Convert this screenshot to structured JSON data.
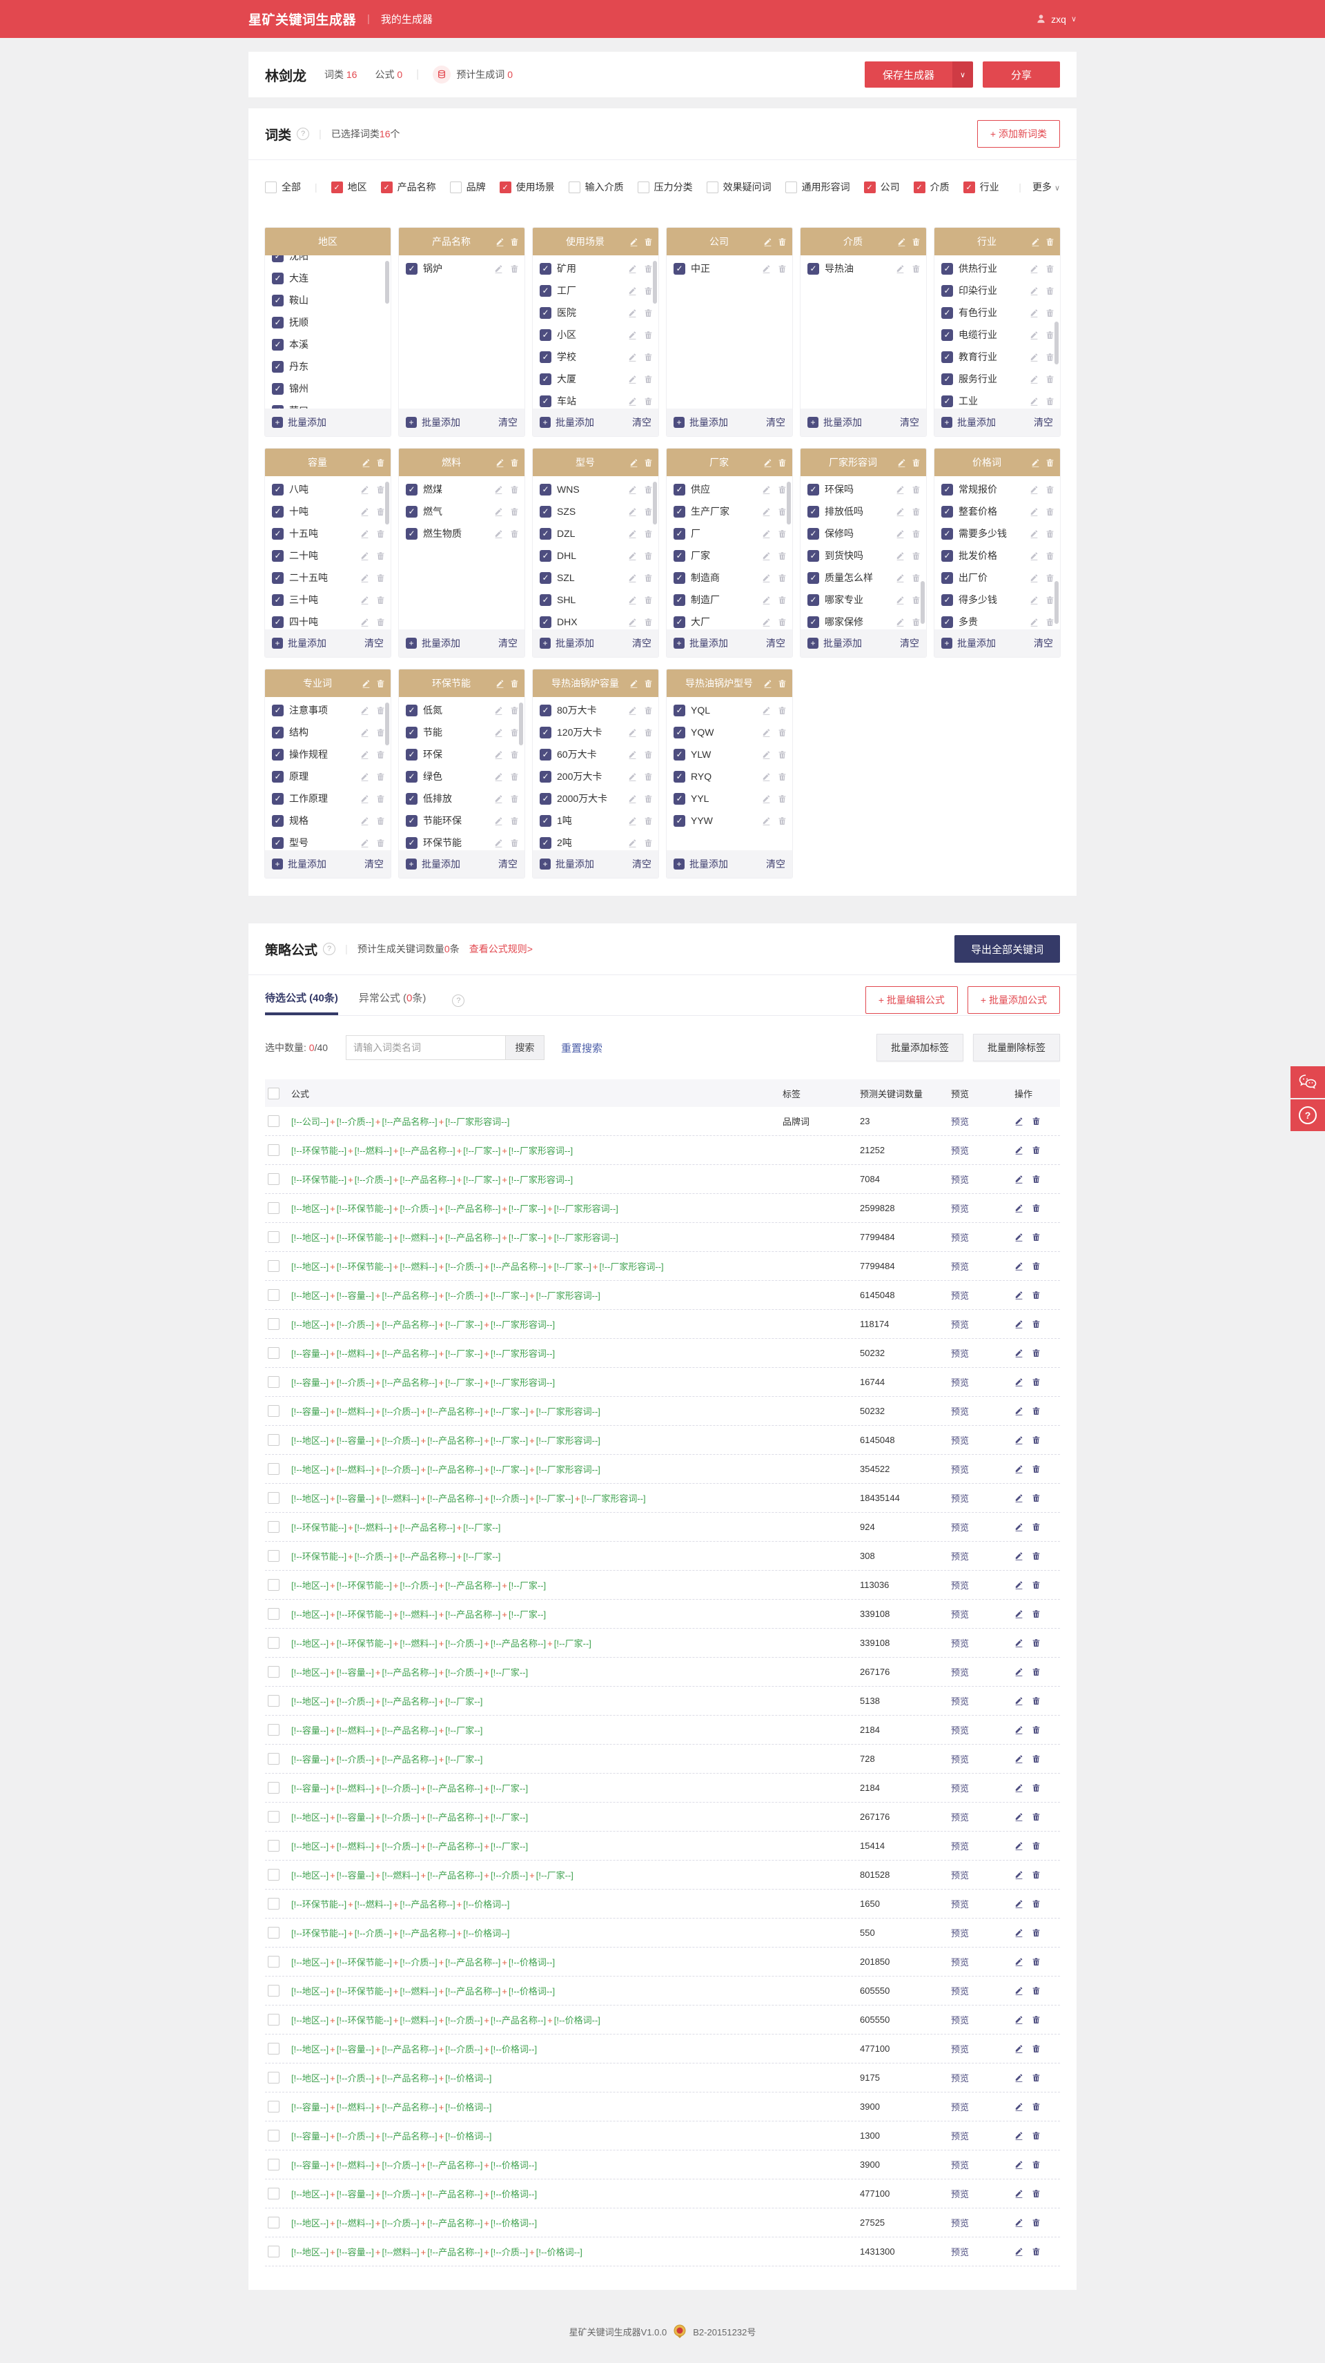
{
  "colors": {
    "primary_red": "#e2484f",
    "navy_button": "#353a68",
    "card_header_tan": "#d0b284",
    "item_checkbox_navy": "#4d4d7f",
    "formula_green": "#3fa14f",
    "formula_plus_orange": "#e25a3d",
    "preview_indigo": "#4e4e80"
  },
  "navbar": {
    "brand": "星矿关键词生成器",
    "menu": "我的生成器",
    "user": "zxq"
  },
  "userbar": {
    "name": "林剑龙",
    "wordclass_label": "词类",
    "wordclass_count": "16",
    "formula_label": "公式",
    "formula_count": "0",
    "estimate_label": "预计生成词",
    "estimate_count": "0",
    "save_button": "保存生成器",
    "share_button": "分享"
  },
  "wordclass_section": {
    "title": "词类",
    "selected_prefix": "已选择词类",
    "selected_count": "16",
    "selected_suffix": "个",
    "add_button": "+ 添加新词类",
    "more_label": "更多",
    "batch_add_label": "批量添加",
    "clear_label": "清空",
    "filters": [
      {
        "label": "全部",
        "checked": false,
        "divider_after": true
      },
      {
        "label": "地区",
        "checked": true
      },
      {
        "label": "产品名称",
        "checked": true
      },
      {
        "label": "品牌",
        "checked": false
      },
      {
        "label": "使用场景",
        "checked": true
      },
      {
        "label": "输入介质",
        "checked": false
      },
      {
        "label": "压力分类",
        "checked": false
      },
      {
        "label": "效果疑问词",
        "checked": false
      },
      {
        "label": "通用形容词",
        "checked": false
      },
      {
        "label": "公司",
        "checked": true
      },
      {
        "label": "介质",
        "checked": true
      },
      {
        "label": "行业",
        "checked": true
      }
    ],
    "cards": [
      {
        "title": "地区",
        "head_icons": false,
        "item_icons": false,
        "clear": false,
        "scrollbar": "top",
        "offset": true,
        "items": [
          "沈阳",
          "大连",
          "鞍山",
          "抚顺",
          "本溪",
          "丹东",
          "锦州",
          "营口"
        ]
      },
      {
        "title": "产品名称",
        "head_icons": true,
        "item_icons": true,
        "clear": true,
        "scrollbar": null,
        "offset": false,
        "items": [
          "锅炉"
        ]
      },
      {
        "title": "使用场景",
        "head_icons": true,
        "item_icons": true,
        "clear": true,
        "scrollbar": "top",
        "offset": false,
        "items": [
          "矿用",
          "工厂",
          "医院",
          "小区",
          "学校",
          "大厦",
          "车站"
        ]
      },
      {
        "title": "公司",
        "head_icons": true,
        "item_icons": true,
        "clear": true,
        "scrollbar": null,
        "offset": false,
        "items": [
          "中正"
        ]
      },
      {
        "title": "介质",
        "head_icons": true,
        "item_icons": true,
        "clear": true,
        "scrollbar": null,
        "offset": false,
        "items": [
          "导热油"
        ]
      },
      {
        "title": "行业",
        "head_icons": true,
        "item_icons": true,
        "clear": true,
        "scrollbar": "mid",
        "offset": false,
        "items": [
          "供热行业",
          "印染行业",
          "有色行业",
          "电缆行业",
          "教育行业",
          "服务行业",
          "工业"
        ]
      },
      {
        "title": "容量",
        "head_icons": true,
        "item_icons": true,
        "clear": true,
        "scrollbar": "top",
        "offset": false,
        "items": [
          "八吨",
          "十吨",
          "十五吨",
          "二十吨",
          "二十五吨",
          "三十吨",
          "四十吨"
        ]
      },
      {
        "title": "燃料",
        "head_icons": true,
        "item_icons": true,
        "clear": true,
        "scrollbar": null,
        "offset": false,
        "items": [
          "燃煤",
          "燃气",
          "燃生物质"
        ]
      },
      {
        "title": "型号",
        "head_icons": true,
        "item_icons": true,
        "clear": true,
        "scrollbar": "top",
        "offset": false,
        "items": [
          "WNS",
          "SZS",
          "DZL",
          "DHL",
          "SZL",
          "SHL",
          "DHX"
        ]
      },
      {
        "title": "厂家",
        "head_icons": true,
        "item_icons": true,
        "clear": true,
        "scrollbar": "top",
        "offset": false,
        "items": [
          "供应",
          "生产厂家",
          "厂",
          "厂家",
          "制造商",
          "制造厂",
          "大厂"
        ]
      },
      {
        "title": "厂家形容词",
        "head_icons": true,
        "item_icons": true,
        "clear": true,
        "scrollbar": "bottom",
        "offset": false,
        "items": [
          "环保吗",
          "排放低吗",
          "保修吗",
          "到货快吗",
          "质量怎么样",
          "哪家专业",
          "哪家保修"
        ]
      },
      {
        "title": "价格词",
        "head_icons": true,
        "item_icons": true,
        "clear": true,
        "scrollbar": "bottom",
        "offset": false,
        "items": [
          "常规报价",
          "整套价格",
          "需要多少钱",
          "批发价格",
          "出厂价",
          "得多少钱",
          "多贵"
        ]
      },
      {
        "title": "专业词",
        "head_icons": true,
        "item_icons": true,
        "clear": true,
        "scrollbar": "top",
        "offset": false,
        "items": [
          "注意事项",
          "结构",
          "操作规程",
          "原理",
          "工作原理",
          "规格",
          "型号"
        ]
      },
      {
        "title": "环保节能",
        "head_icons": true,
        "item_icons": true,
        "clear": true,
        "scrollbar": "top",
        "offset": false,
        "items": [
          "低氮",
          "节能",
          "环保",
          "绿色",
          "低排放",
          "节能环保",
          "环保节能"
        ]
      },
      {
        "title": "导热油锅炉容量",
        "head_icons": true,
        "item_icons": true,
        "clear": true,
        "scrollbar": null,
        "offset": false,
        "items": [
          "80万大卡",
          "120万大卡",
          "60万大卡",
          "200万大卡",
          "2000万大卡",
          "1吨",
          "2吨"
        ]
      },
      {
        "title": "导热油锅炉型号",
        "head_icons": true,
        "item_icons": true,
        "clear": true,
        "scrollbar": null,
        "offset": false,
        "items": [
          "YQL",
          "YQW",
          "YLW",
          "RYQ",
          "YYL",
          "YYW"
        ]
      }
    ]
  },
  "formula_section": {
    "title": "策略公式",
    "estimate_prefix": "预计生成关键词数量",
    "estimate_count": "0",
    "estimate_suffix": "条",
    "rules_link": "查看公式规则>",
    "export_button": "导出全部关键词",
    "tabs": [
      {
        "name": "待选公式",
        "count": "40",
        "suffix": "条",
        "active": true,
        "count_red": false
      },
      {
        "name": "异常公式",
        "count": "0",
        "suffix": "条",
        "active": false,
        "count_red": true
      }
    ],
    "batch_edit_button": "+ 批量编辑公式",
    "batch_add_button": "+ 批量添加公式",
    "selected_label": "选中数量:",
    "selected_zero": "0",
    "selected_total": "/40",
    "search_placeholder": "请输入词类名词",
    "search_button": "搜索",
    "reset_button": "重置搜索",
    "tag_add_button": "批量添加标签",
    "tag_del_button": "批量删除标签",
    "table": {
      "headers": {
        "formula": "公式",
        "tag": "标签",
        "count": "预测关键词数量",
        "preview": "预览",
        "ops": "操作"
      },
      "preview_label": "预览",
      "rows": [
        {
          "parts": [
            "公司",
            "介质",
            "产品名称",
            "厂家形容词"
          ],
          "tag": "品牌词",
          "count": "23"
        },
        {
          "parts": [
            "环保节能",
            "燃料",
            "产品名称",
            "厂家",
            "厂家形容词"
          ],
          "tag": "",
          "count": "21252"
        },
        {
          "parts": [
            "环保节能",
            "介质",
            "产品名称",
            "厂家",
            "厂家形容词"
          ],
          "tag": "",
          "count": "7084"
        },
        {
          "parts": [
            "地区",
            "环保节能",
            "介质",
            "产品名称",
            "厂家",
            "厂家形容词"
          ],
          "tag": "",
          "count": "2599828"
        },
        {
          "parts": [
            "地区",
            "环保节能",
            "燃料",
            "产品名称",
            "厂家",
            "厂家形容词"
          ],
          "tag": "",
          "count": "7799484"
        },
        {
          "parts": [
            "地区",
            "环保节能",
            "燃料",
            "介质",
            "产品名称",
            "厂家",
            "厂家形容词"
          ],
          "tag": "",
          "count": "7799484"
        },
        {
          "parts": [
            "地区",
            "容量",
            "产品名称",
            "介质",
            "厂家",
            "厂家形容词"
          ],
          "tag": "",
          "count": "6145048"
        },
        {
          "parts": [
            "地区",
            "介质",
            "产品名称",
            "厂家",
            "厂家形容词"
          ],
          "tag": "",
          "count": "118174"
        },
        {
          "parts": [
            "容量",
            "燃料",
            "产品名称",
            "厂家",
            "厂家形容词"
          ],
          "tag": "",
          "count": "50232"
        },
        {
          "parts": [
            "容量",
            "介质",
            "产品名称",
            "厂家",
            "厂家形容词"
          ],
          "tag": "",
          "count": "16744"
        },
        {
          "parts": [
            "容量",
            "燃料",
            "介质",
            "产品名称",
            "厂家",
            "厂家形容词"
          ],
          "tag": "",
          "count": "50232"
        },
        {
          "parts": [
            "地区",
            "容量",
            "介质",
            "产品名称",
            "厂家",
            "厂家形容词"
          ],
          "tag": "",
          "count": "6145048"
        },
        {
          "parts": [
            "地区",
            "燃料",
            "介质",
            "产品名称",
            "厂家",
            "厂家形容词"
          ],
          "tag": "",
          "count": "354522"
        },
        {
          "parts": [
            "地区",
            "容量",
            "燃料",
            "产品名称",
            "介质",
            "厂家",
            "厂家形容词"
          ],
          "tag": "",
          "count": "18435144"
        },
        {
          "parts": [
            "环保节能",
            "燃料",
            "产品名称",
            "厂家"
          ],
          "tag": "",
          "count": "924"
        },
        {
          "parts": [
            "环保节能",
            "介质",
            "产品名称",
            "厂家"
          ],
          "tag": "",
          "count": "308"
        },
        {
          "parts": [
            "地区",
            "环保节能",
            "介质",
            "产品名称",
            "厂家"
          ],
          "tag": "",
          "count": "113036"
        },
        {
          "parts": [
            "地区",
            "环保节能",
            "燃料",
            "产品名称",
            "厂家"
          ],
          "tag": "",
          "count": "339108"
        },
        {
          "parts": [
            "地区",
            "环保节能",
            "燃料",
            "介质",
            "产品名称",
            "厂家"
          ],
          "tag": "",
          "count": "339108"
        },
        {
          "parts": [
            "地区",
            "容量",
            "产品名称",
            "介质",
            "厂家"
          ],
          "tag": "",
          "count": "267176"
        },
        {
          "parts": [
            "地区",
            "介质",
            "产品名称",
            "厂家"
          ],
          "tag": "",
          "count": "5138"
        },
        {
          "parts": [
            "容量",
            "燃料",
            "产品名称",
            "厂家"
          ],
          "tag": "",
          "count": "2184"
        },
        {
          "parts": [
            "容量",
            "介质",
            "产品名称",
            "厂家"
          ],
          "tag": "",
          "count": "728"
        },
        {
          "parts": [
            "容量",
            "燃料",
            "介质",
            "产品名称",
            "厂家"
          ],
          "tag": "",
          "count": "2184"
        },
        {
          "parts": [
            "地区",
            "容量",
            "介质",
            "产品名称",
            "厂家"
          ],
          "tag": "",
          "count": "267176"
        },
        {
          "parts": [
            "地区",
            "燃料",
            "介质",
            "产品名称",
            "厂家"
          ],
          "tag": "",
          "count": "15414"
        },
        {
          "parts": [
            "地区",
            "容量",
            "燃料",
            "产品名称",
            "介质",
            "厂家"
          ],
          "tag": "",
          "count": "801528"
        },
        {
          "parts": [
            "环保节能",
            "燃料",
            "产品名称",
            "价格词"
          ],
          "tag": "",
          "count": "1650"
        },
        {
          "parts": [
            "环保节能",
            "介质",
            "产品名称",
            "价格词"
          ],
          "tag": "",
          "count": "550"
        },
        {
          "parts": [
            "地区",
            "环保节能",
            "介质",
            "产品名称",
            "价格词"
          ],
          "tag": "",
          "count": "201850"
        },
        {
          "parts": [
            "地区",
            "环保节能",
            "燃料",
            "产品名称",
            "价格词"
          ],
          "tag": "",
          "count": "605550"
        },
        {
          "parts": [
            "地区",
            "环保节能",
            "燃料",
            "介质",
            "产品名称",
            "价格词"
          ],
          "tag": "",
          "count": "605550"
        },
        {
          "parts": [
            "地区",
            "容量",
            "产品名称",
            "介质",
            "价格词"
          ],
          "tag": "",
          "count": "477100"
        },
        {
          "parts": [
            "地区",
            "介质",
            "产品名称",
            "价格词"
          ],
          "tag": "",
          "count": "9175"
        },
        {
          "parts": [
            "容量",
            "燃料",
            "产品名称",
            "价格词"
          ],
          "tag": "",
          "count": "3900"
        },
        {
          "parts": [
            "容量",
            "介质",
            "产品名称",
            "价格词"
          ],
          "tag": "",
          "count": "1300"
        },
        {
          "parts": [
            "容量",
            "燃料",
            "介质",
            "产品名称",
            "价格词"
          ],
          "tag": "",
          "count": "3900"
        },
        {
          "parts": [
            "地区",
            "容量",
            "介质",
            "产品名称",
            "价格词"
          ],
          "tag": "",
          "count": "477100"
        },
        {
          "parts": [
            "地区",
            "燃料",
            "介质",
            "产品名称",
            "价格词"
          ],
          "tag": "",
          "count": "27525"
        },
        {
          "parts": [
            "地区",
            "容量",
            "燃料",
            "产品名称",
            "介质",
            "价格词"
          ],
          "tag": "",
          "count": "1431300"
        }
      ]
    }
  },
  "footer": {
    "version": "星矿关键词生成器V1.0.0",
    "icp": "B2-20151232号"
  }
}
